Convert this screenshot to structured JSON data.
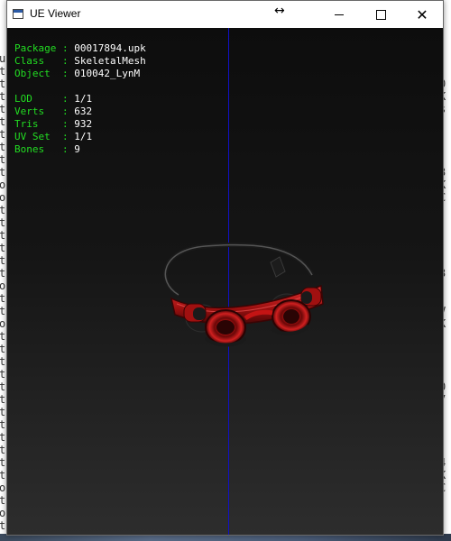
{
  "window": {
    "title": "UE Viewer",
    "resize_glyph": "↔",
    "close_glyph": "✕"
  },
  "info": {
    "rows": [
      {
        "key": "Package",
        "sep": " : ",
        "value": "00017894.upk"
      },
      {
        "key": "Class  ",
        "sep": " : ",
        "value": "SkeletalMesh"
      },
      {
        "key": "Object ",
        "sep": " : ",
        "value": "010042_LynM"
      }
    ],
    "stats": [
      {
        "key": "LOD    ",
        "sep": " : ",
        "value": "1/1"
      },
      {
        "key": "Verts  ",
        "sep": " : ",
        "value": "632"
      },
      {
        "key": "Tris   ",
        "sep": " : ",
        "value": "932"
      },
      {
        "key": "UV Set ",
        "sep": " : ",
        "value": "1/1"
      },
      {
        "key": "Bones  ",
        "sep": " : ",
        "value": "9"
      }
    ]
  },
  "background_console": {
    "left_chars": [
      "u",
      "t",
      "t",
      "t",
      "t",
      "t",
      "t",
      "t",
      "t",
      "t",
      "o",
      "o",
      "t",
      "t",
      "t",
      "t",
      "t",
      "t",
      "o",
      "t",
      "t",
      "o",
      "t",
      "t",
      "t",
      "t",
      "t",
      "t",
      "t",
      "t",
      "t",
      "t",
      "t",
      "t",
      "o",
      "t",
      "o",
      "t"
    ],
    "right_chars": [
      "",
      "",
      "0",
      "K",
      "s",
      "",
      "",
      "",
      "",
      "3",
      "K",
      "C",
      "",
      "",
      "",
      "",
      "",
      "3",
      "",
      "",
      "V",
      "K",
      "",
      "",
      "",
      "",
      "0",
      "7",
      "",
      "",
      "",
      "",
      "4",
      "K",
      "C",
      "",
      ""
    ]
  },
  "colors": {
    "label_green": "#22dd22",
    "axis_blue": "#1010c8",
    "mesh_red": "#c41414"
  }
}
